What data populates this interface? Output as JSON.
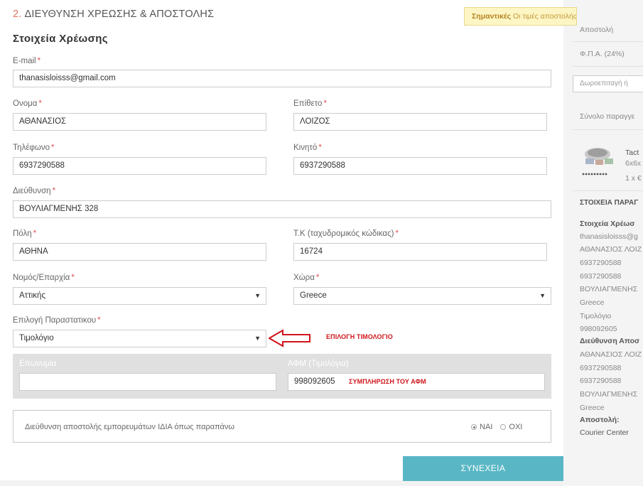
{
  "step": {
    "number": "2.",
    "title": "ΔΙΕΥΘΥΝΣΗ ΧΡΕΩΣΗΣ & ΑΠΟΣΤΟΛΗΣ"
  },
  "section_title": "Στοιχεία Χρέωσης",
  "required_mark": "*",
  "fields": {
    "email": {
      "label": "E-mail",
      "value": "thanasisloisss@gmail.com"
    },
    "first_name": {
      "label": "Ονομα",
      "value": "ΑΘΑΝΑΣΙΟΣ"
    },
    "last_name": {
      "label": "Επίθετο",
      "value": "ΛΟΙΖΟΣ"
    },
    "phone": {
      "label": "Τηλέφωνο",
      "value": "6937290588"
    },
    "mobile": {
      "label": "Κινητό",
      "value": "6937290588"
    },
    "address": {
      "label": "Διεύθυνση",
      "value": "ΒΟΥΛΙΑΓΜΕΝΗΣ 328"
    },
    "city": {
      "label": "Πόλη",
      "value": "ΑΘΗΝΑ"
    },
    "postcode": {
      "label": "Τ.Κ (ταχυδρομικός κώδικας)",
      "value": "16724"
    },
    "region": {
      "label": "Νομός/Επαρχία",
      "value": "Αττικής"
    },
    "country": {
      "label": "Χώρα",
      "value": "Greece"
    },
    "document": {
      "label": "Επιλογή Παραστατικου",
      "value": "Τιμολόγιο"
    }
  },
  "invoice": {
    "company_label": "Επωνυμία",
    "company_value": "",
    "vat_label": "ΑΦΜ (Τιμολόγια)",
    "vat_value": "998092605"
  },
  "annotations": {
    "invoice_select": "ΕΠΙΛΟΓΗ ΤΙΜΟΛΟΓΙΟ",
    "vat_fill": "ΣΥΜΠΛΗΡΩΣΗ ΤΟΥ ΑΦΜ"
  },
  "shipping_same": {
    "question": "Διεύθυνση αποστολής εμπορευμάτων ΙΔΙΑ όπως παραπάνω",
    "yes": "ΝΑΙ",
    "no": "ΟΧΙ",
    "selected": "yes"
  },
  "continue_button": "ΣΥΝΕΧΕΙΑ",
  "notice": {
    "strong": "Σημαντικές",
    "text": "Οι τιμές αποστολής άλλαξαν"
  },
  "sidebar": {
    "shipping_row": "Αποστολή",
    "vat_row": "Φ.Π.Α. (24%)",
    "coupon_placeholder": "Δωροεπιταγή ή",
    "order_total": "Σύνολο παραγγε",
    "product_name_1": "Tact",
    "product_name_2": "6x6x",
    "product_qty": "1 x €",
    "info_heading": "ΣΤΟΙΧΕΙΑ ΠΑΡΑΓ",
    "billing_heading": "Στοιχεία Χρέωσ",
    "billing_lines": [
      "thanasisloisss@g",
      "ΑΘΑΝΑΣΙΟΣ ΛΟΙΖ",
      "6937290588",
      "6937290588",
      "ΒΟΥΛΙΑΓΜΕΝΗΣ",
      "Greece",
      "Τιμολόγιο",
      "998092605"
    ],
    "shipping_heading": "Διεύθυνση Αποσ",
    "shipping_lines": [
      "ΑΘΑΝΑΣΙΟΣ ΛΟΙΖ",
      "6937290588",
      "6937290588",
      "ΒΟΥΛΙΑΓΜΕΝΗΣ",
      "Greece"
    ],
    "carrier_heading": "Αποστολή:",
    "carrier_value": "Courier Center"
  },
  "colors": {
    "accent": "#e07a5f",
    "button": "#59b7c5",
    "annotation": "#d0141a",
    "notice_bg": "#fdf5c4"
  }
}
